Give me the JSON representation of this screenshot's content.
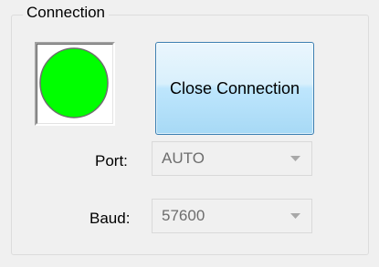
{
  "connection_group": {
    "title": "Connection",
    "status_indicator": {
      "icon": "status-led-icon",
      "color": "#00ff00",
      "state": "connected"
    },
    "close_button_label": "Close Connection",
    "port": {
      "label": "Port:",
      "value": "AUTO",
      "enabled": false
    },
    "baud": {
      "label": "Baud:",
      "value": "57600",
      "enabled": false
    }
  }
}
